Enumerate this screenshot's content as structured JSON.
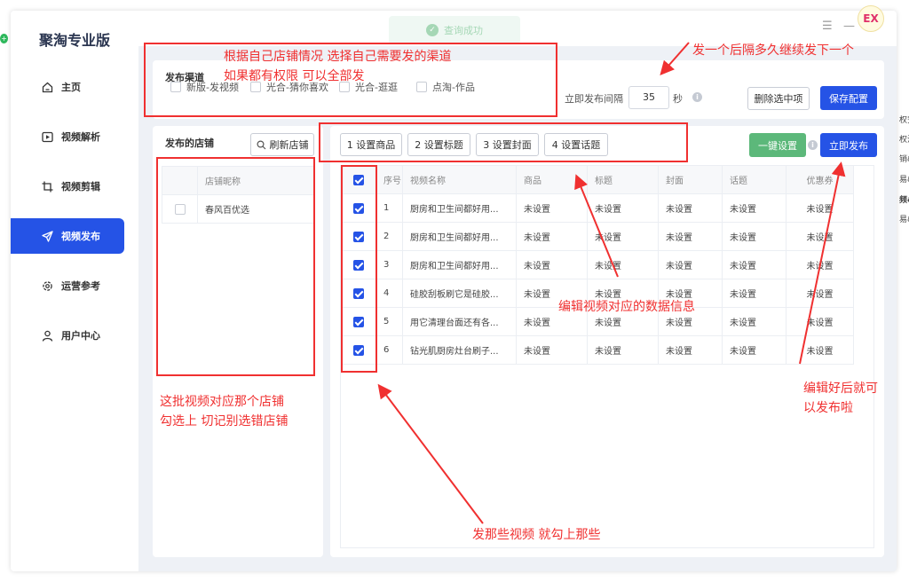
{
  "app": {
    "title": "聚淘专业版"
  },
  "sidebar": {
    "items": [
      {
        "label": "主页",
        "icon": "home-icon"
      },
      {
        "label": "视频解析",
        "icon": "play-icon"
      },
      {
        "label": "视频剪辑",
        "icon": "crop-icon"
      },
      {
        "label": "视频发布",
        "icon": "send-icon",
        "active": true
      },
      {
        "label": "运营参考",
        "icon": "settings-icon"
      },
      {
        "label": "用户中心",
        "icon": "user-icon"
      }
    ]
  },
  "toast": {
    "text": "查询成功"
  },
  "window_controls": {
    "menu": "☰",
    "minimize": "—",
    "maximize": "☐",
    "badge": "EX"
  },
  "channels": {
    "label": "发布渠道",
    "items": [
      {
        "label": "新版-发视频",
        "checked": false
      },
      {
        "label": "光合-猜你喜欢",
        "checked": false
      },
      {
        "label": "光合-逛逛",
        "checked": false
      },
      {
        "label": "点淘-作品",
        "checked": false
      }
    ],
    "interval_label": "立即发布间隔",
    "interval_value": "35",
    "interval_unit": "秒",
    "delete_selected": "删除选中项",
    "save_config": "保存配置"
  },
  "shops": {
    "title": "发布的店铺",
    "refresh": "刷新店铺",
    "column": "店铺昵称",
    "rows": [
      {
        "name": "春风百优选",
        "checked": false
      }
    ]
  },
  "steps": {
    "items": [
      "1 设置商品",
      "2 设置标题",
      "3 设置封面",
      "4 设置话题"
    ],
    "one_click": "一键设置",
    "publish_now": "立即发布"
  },
  "videos": {
    "columns": [
      "序号",
      "视频名称",
      "商品",
      "标题",
      "封面",
      "话题",
      "优惠券"
    ],
    "rows": [
      {
        "index": "1",
        "name": "厨房和卫生间都好用...",
        "product": "未设置",
        "title": "未设置",
        "cover": "未设置",
        "topic": "未设置",
        "coupon": "未设置"
      },
      {
        "index": "2",
        "name": "厨房和卫生间都好用...",
        "product": "未设置",
        "title": "未设置",
        "cover": "未设置",
        "topic": "未设置",
        "coupon": "未设置"
      },
      {
        "index": "3",
        "name": "厨房和卫生间都好用...",
        "product": "未设置",
        "title": "未设置",
        "cover": "未设置",
        "topic": "未设置",
        "coupon": "未设置"
      },
      {
        "index": "4",
        "name": "硅胶刮板刷它是硅胶...",
        "product": "未设置",
        "title": "未设置",
        "cover": "未设置",
        "topic": "未设置",
        "coupon": "未设置"
      },
      {
        "index": "5",
        "name": "用它清理台面还有各...",
        "product": "未设置",
        "title": "未设置",
        "cover": "未设置",
        "topic": "未设置",
        "coupon": "未设置"
      },
      {
        "index": "6",
        "name": "钻光肌厨房灶台刷子...",
        "product": "未设置",
        "title": "未设置",
        "cover": "未设置",
        "topic": "未设置",
        "coupon": "未设置"
      }
    ]
  },
  "annotations": {
    "channels_line1": "根据自己店铺情况 选择自己需要发的渠道",
    "channels_line2": "如果都有权限 可以全部发",
    "interval": "发一个后隔多久继续发下一个",
    "shop_line1": "这批视频对应那个店铺",
    "shop_line2": "勾选上  切记别选错店铺",
    "edit_info": "编辑视频对应的数据信息",
    "publish_line1": "编辑好后就可",
    "publish_line2": "以发布啦",
    "select_videos": "发那些视频  就勾上那些"
  },
  "colors": {
    "accent": "#2553e6",
    "annotation": "#f03030",
    "success": "#5cb87a"
  },
  "right_edge_fragments": [
    "权安",
    "权注",
    "销&",
    "易&",
    "频&",
    "易&"
  ]
}
